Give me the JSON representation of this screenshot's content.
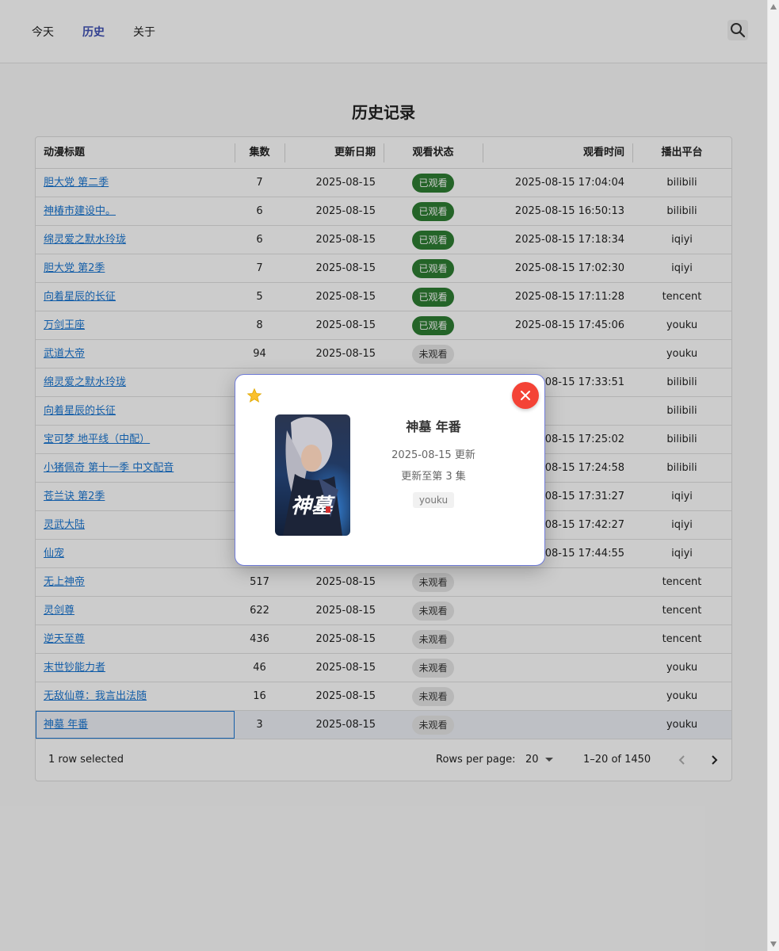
{
  "nav": {
    "items": [
      {
        "label": "今天",
        "active": false
      },
      {
        "label": "历史",
        "active": true
      },
      {
        "label": "关于",
        "active": false
      }
    ],
    "search_icon": "search-icon"
  },
  "page": {
    "title": "历史记录"
  },
  "table": {
    "columns": [
      "动漫标题",
      "集数",
      "更新日期",
      "观看状态",
      "观看时间",
      "播出平台"
    ],
    "rows": [
      {
        "title": "胆大党 第二季",
        "episodes": "7",
        "date": "2025-08-15",
        "status": "已观看",
        "watched": true,
        "time": "2025-08-15 17:04:04",
        "platform": "bilibili"
      },
      {
        "title": "神椿市建设中。",
        "episodes": "6",
        "date": "2025-08-15",
        "status": "已观看",
        "watched": true,
        "time": "2025-08-15 16:50:13",
        "platform": "bilibili"
      },
      {
        "title": "绵灵爱之默水玲珑",
        "episodes": "6",
        "date": "2025-08-15",
        "status": "已观看",
        "watched": true,
        "time": "2025-08-15 17:18:34",
        "platform": "iqiyi"
      },
      {
        "title": "胆大党 第2季",
        "episodes": "7",
        "date": "2025-08-15",
        "status": "已观看",
        "watched": true,
        "time": "2025-08-15 17:02:30",
        "platform": "iqiyi"
      },
      {
        "title": "向着星辰的长征",
        "episodes": "5",
        "date": "2025-08-15",
        "status": "已观看",
        "watched": true,
        "time": "2025-08-15 17:11:28",
        "platform": "tencent"
      },
      {
        "title": "万剑王座",
        "episodes": "8",
        "date": "2025-08-15",
        "status": "已观看",
        "watched": true,
        "time": "2025-08-15 17:45:06",
        "platform": "youku"
      },
      {
        "title": "武道大帝",
        "episodes": "94",
        "date": "2025-08-15",
        "status": "未观看",
        "watched": false,
        "time": "",
        "platform": "youku"
      },
      {
        "title": "绵灵爱之默水玲珑",
        "episodes": "",
        "date": "",
        "status": "",
        "watched": true,
        "time": "5-08-15 17:33:51",
        "platform": "bilibili"
      },
      {
        "title": "向着星辰的长征",
        "episodes": "",
        "date": "",
        "status": "",
        "watched": false,
        "time": "",
        "platform": "bilibili"
      },
      {
        "title": "宝可梦 地平线（中配）",
        "episodes": "",
        "date": "",
        "status": "",
        "watched": false,
        "time": "5-08-15 17:25:02",
        "platform": "bilibili"
      },
      {
        "title": "小猪佩奇 第十一季 中文配音",
        "episodes": "",
        "date": "",
        "status": "",
        "watched": false,
        "time": "5-08-15 17:24:58",
        "platform": "bilibili"
      },
      {
        "title": "苍兰诀 第2季",
        "episodes": "",
        "date": "",
        "status": "",
        "watched": false,
        "time": "5-08-15 17:31:27",
        "platform": "iqiyi"
      },
      {
        "title": "灵武大陆",
        "episodes": "",
        "date": "",
        "status": "",
        "watched": false,
        "time": "5-08-15 17:42:27",
        "platform": "iqiyi"
      },
      {
        "title": "仙宠",
        "episodes": "",
        "date": "",
        "status": "",
        "watched": false,
        "time": "5-08-15 17:44:55",
        "platform": "iqiyi"
      },
      {
        "title": "无上神帝",
        "episodes": "517",
        "date": "2025-08-15",
        "status": "未观看",
        "watched": false,
        "time": "",
        "platform": "tencent"
      },
      {
        "title": "灵剑尊",
        "episodes": "622",
        "date": "2025-08-15",
        "status": "未观看",
        "watched": false,
        "time": "",
        "platform": "tencent"
      },
      {
        "title": "逆天至尊",
        "episodes": "436",
        "date": "2025-08-15",
        "status": "未观看",
        "watched": false,
        "time": "",
        "platform": "tencent"
      },
      {
        "title": "末世钞能力者",
        "episodes": "46",
        "date": "2025-08-15",
        "status": "未观看",
        "watched": false,
        "time": "",
        "platform": "youku"
      },
      {
        "title": "无敌仙尊：我言出法随",
        "episodes": "16",
        "date": "2025-08-15",
        "status": "未观看",
        "watched": false,
        "time": "",
        "platform": "youku"
      },
      {
        "title": "神墓 年番",
        "episodes": "3",
        "date": "2025-08-15",
        "status": "未观看",
        "watched": false,
        "time": "",
        "platform": "youku",
        "selected": true
      }
    ]
  },
  "footer": {
    "selected_text": "1 row selected",
    "rows_per_page_label": "Rows per page:",
    "rows_per_page_value": "20",
    "range_text": "1–20 of 1450"
  },
  "dialog": {
    "title": "神墓 年番",
    "update_date": "2025-08-15 更新",
    "episode_text": "更新至第 3 集",
    "platform": "youku",
    "poster_text": "神墓",
    "star_icon": "star-icon",
    "close_icon": "close-icon"
  },
  "colors": {
    "accent": "#3f51b5",
    "link": "#1976d2",
    "watched_chip": "#2e7d32",
    "close_button": "#f44336",
    "star": "#fbc02d"
  }
}
